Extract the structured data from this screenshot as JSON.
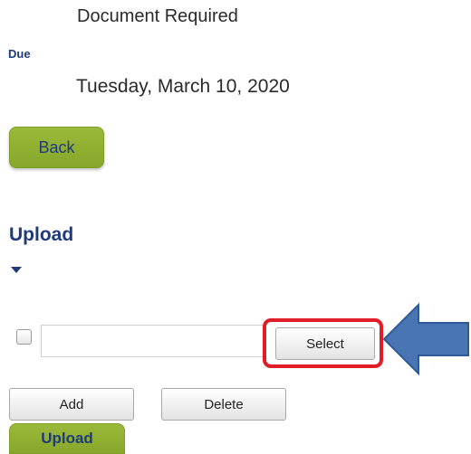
{
  "document": {
    "status": "Document Required"
  },
  "due": {
    "label": "Due",
    "value": "Tuesday, March 10, 2020"
  },
  "actions": {
    "back_label": "Back"
  },
  "upload": {
    "heading": "Upload",
    "file_path_value": "",
    "select_label": "Select",
    "add_label": "Add",
    "delete_label": "Delete",
    "upload_label": "Upload"
  },
  "annotation": {
    "highlight_color": "#e11d2a",
    "arrow_color": "#4a75b3",
    "arrow_icon": "arrow-left-icon"
  },
  "colors": {
    "accent_green": "#8fb03a",
    "heading_blue": "#1f3a7a"
  }
}
